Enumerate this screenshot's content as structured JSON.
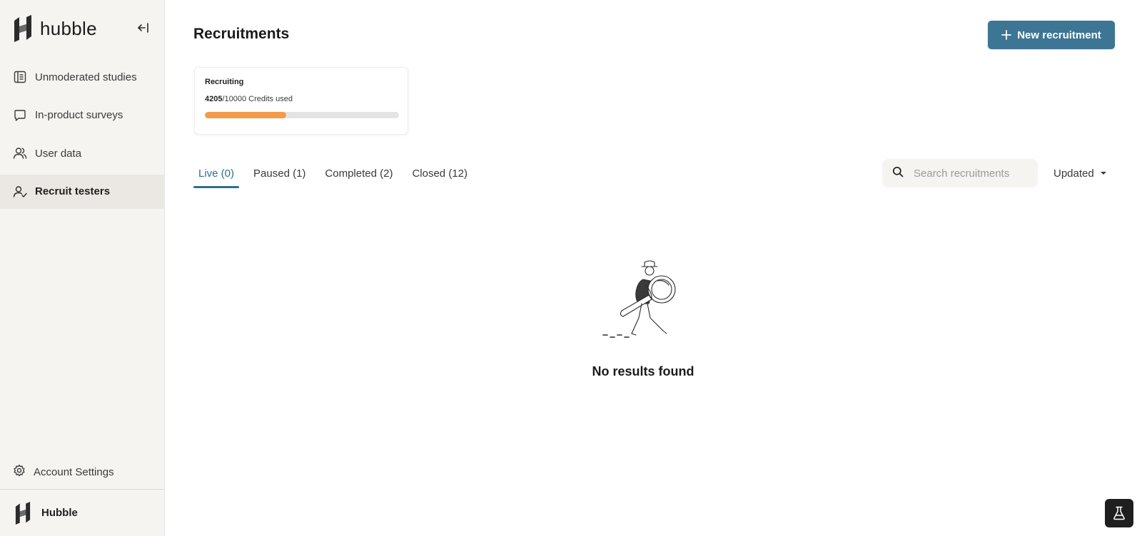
{
  "sidebar": {
    "brand_name": "hubble",
    "items": [
      {
        "label": "Unmoderated studies",
        "icon": "studies-icon"
      },
      {
        "label": "In-product surveys",
        "icon": "chat-bubble-icon"
      },
      {
        "label": "User data",
        "icon": "users-icon"
      },
      {
        "label": "Recruit testers",
        "icon": "user-check-icon",
        "active": true
      }
    ],
    "settings_label": "Account Settings",
    "workspace_name": "Hubble"
  },
  "header": {
    "title": "Recruitments",
    "new_button_label": "New recruitment"
  },
  "credits_card": {
    "title": "Recruiting",
    "used": "4205",
    "total_text": "/10000 Credits used",
    "progress_fraction": 0.42
  },
  "tabs": [
    {
      "label": "Live (0)",
      "active": true
    },
    {
      "label": "Paused (1)"
    },
    {
      "label": "Completed (2)"
    },
    {
      "label": "Closed (12)"
    }
  ],
  "search": {
    "placeholder": "Search recruitments",
    "value": ""
  },
  "sort": {
    "selected": "Updated"
  },
  "empty_state": {
    "message": "No results found"
  },
  "colors": {
    "accent": "#3d7594",
    "progress": "#f29b4b",
    "sidebar_bg": "#f6f4f1"
  }
}
